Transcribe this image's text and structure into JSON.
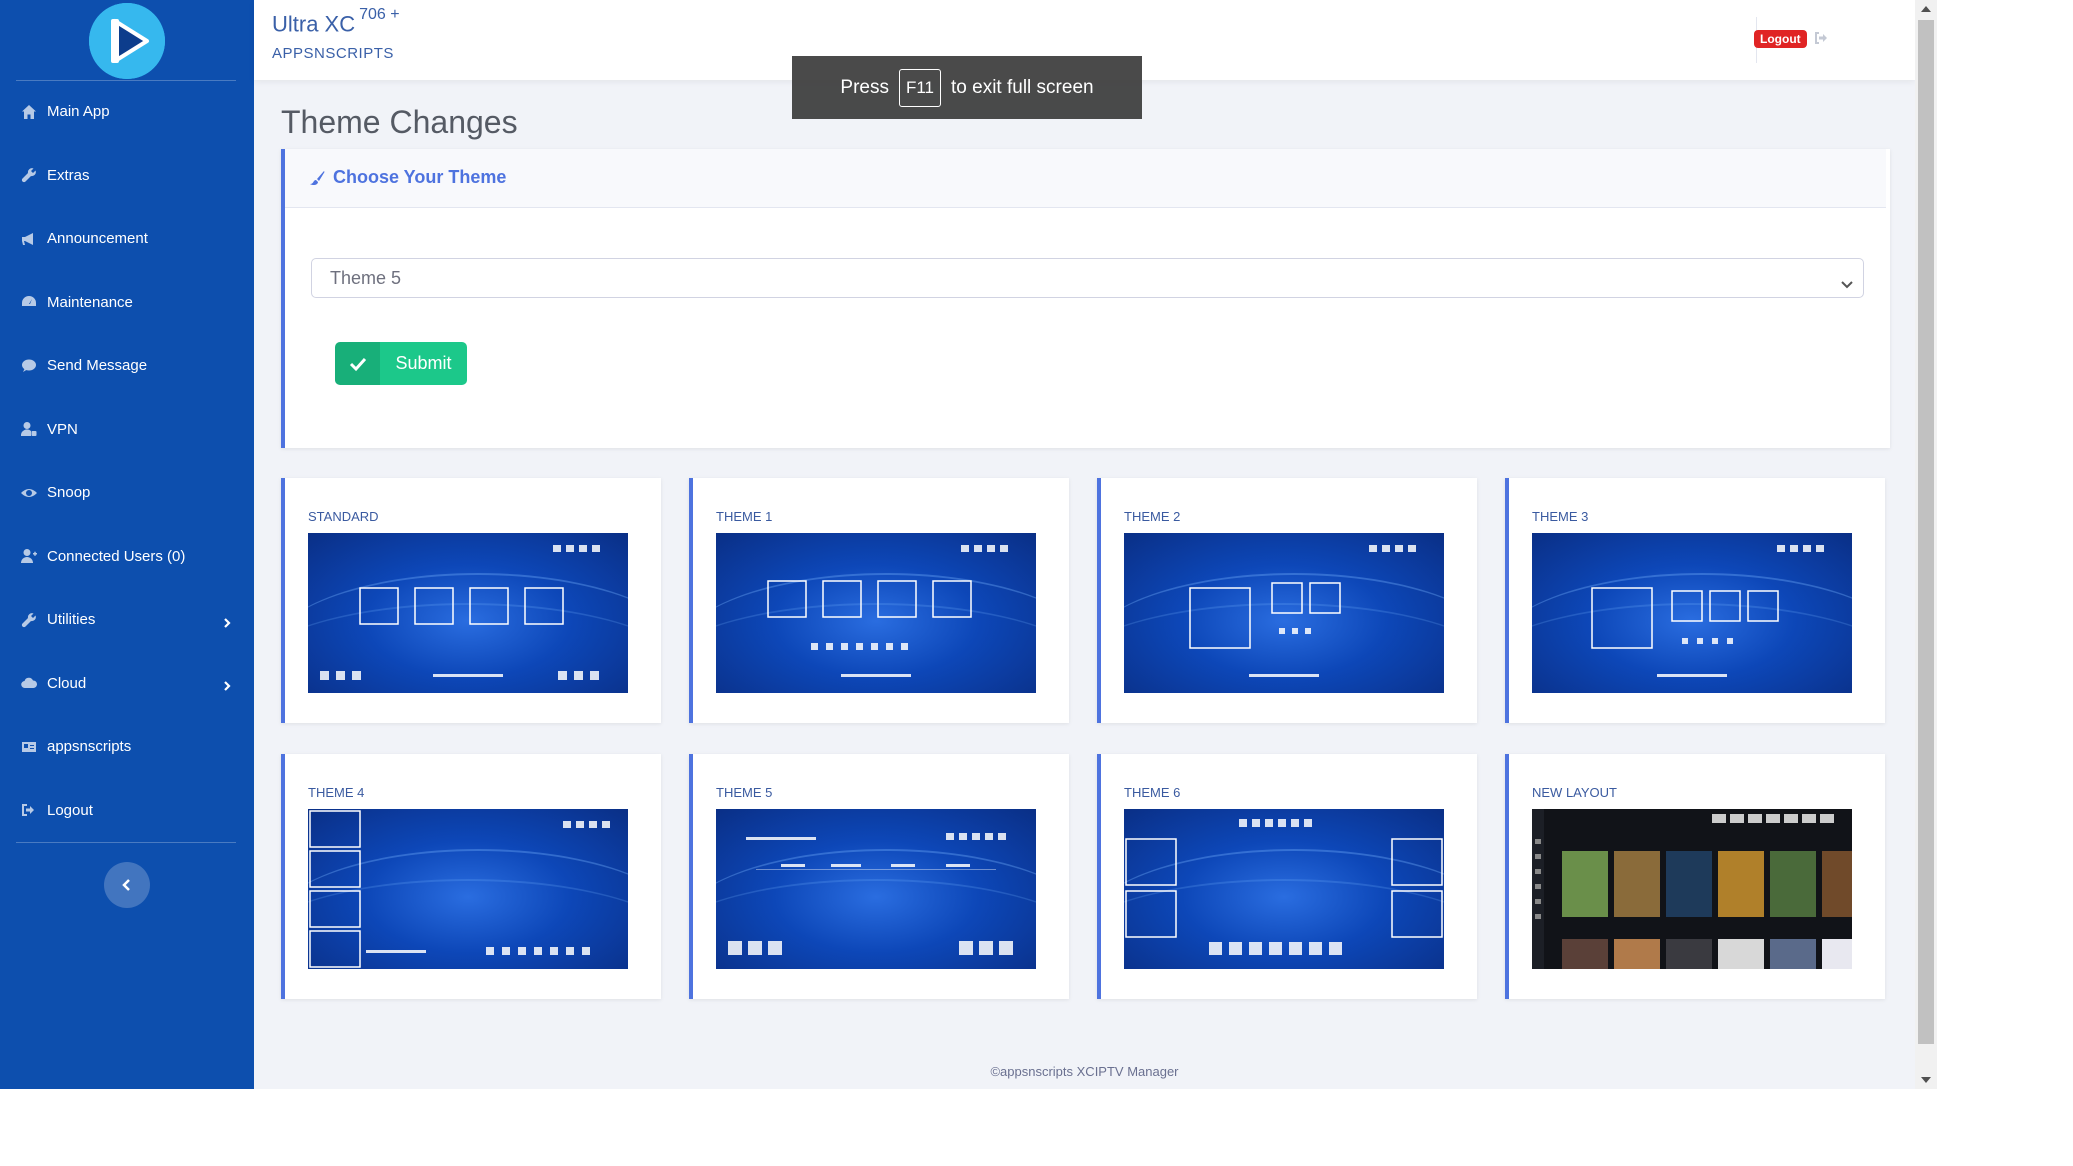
{
  "header": {
    "app_name": "Ultra XC",
    "version": "706 +",
    "subtitle": "APPSNSCRIPTS",
    "logout_badge": "Logout"
  },
  "overlay": {
    "press": "Press",
    "key": "F11",
    "message": "to exit full screen"
  },
  "sidebar": {
    "items": [
      {
        "label": "Main App",
        "icon": "home-icon"
      },
      {
        "label": "Extras",
        "icon": "wrench-icon"
      },
      {
        "label": "Announcement",
        "icon": "megaphone-icon"
      },
      {
        "label": "Maintenance",
        "icon": "gauge-icon"
      },
      {
        "label": "Send Message",
        "icon": "chat-icon"
      },
      {
        "label": "VPN",
        "icon": "user-lock-icon"
      },
      {
        "label": "Snoop",
        "icon": "eye-icon"
      },
      {
        "label": "Connected Users (0)",
        "icon": "user-plus-icon"
      },
      {
        "label": "Utilities",
        "icon": "wrench-icon"
      },
      {
        "label": "Cloud",
        "icon": "cloud-icon"
      },
      {
        "label": "appsnscripts",
        "icon": "id-card-icon"
      },
      {
        "label": "Logout",
        "icon": "sign-out-icon"
      }
    ]
  },
  "main": {
    "page_title": "Theme Changes",
    "card_title": "Choose Your Theme",
    "selected_theme": "Theme 5",
    "submit_label": "Submit"
  },
  "themes": [
    {
      "name": "STANDARD"
    },
    {
      "name": "THEME 1"
    },
    {
      "name": "THEME 2"
    },
    {
      "name": "THEME 3"
    },
    {
      "name": "THEME 4"
    },
    {
      "name": "THEME 5"
    },
    {
      "name": "THEME 6"
    },
    {
      "name": "NEW LAYOUT"
    }
  ],
  "footer": {
    "text": "©appsnscripts XCIPTV Manager"
  },
  "colors": {
    "sidebar": "#0d4fae",
    "accent": "#4e73df",
    "success": "#1cc88a",
    "danger": "#e02424"
  }
}
